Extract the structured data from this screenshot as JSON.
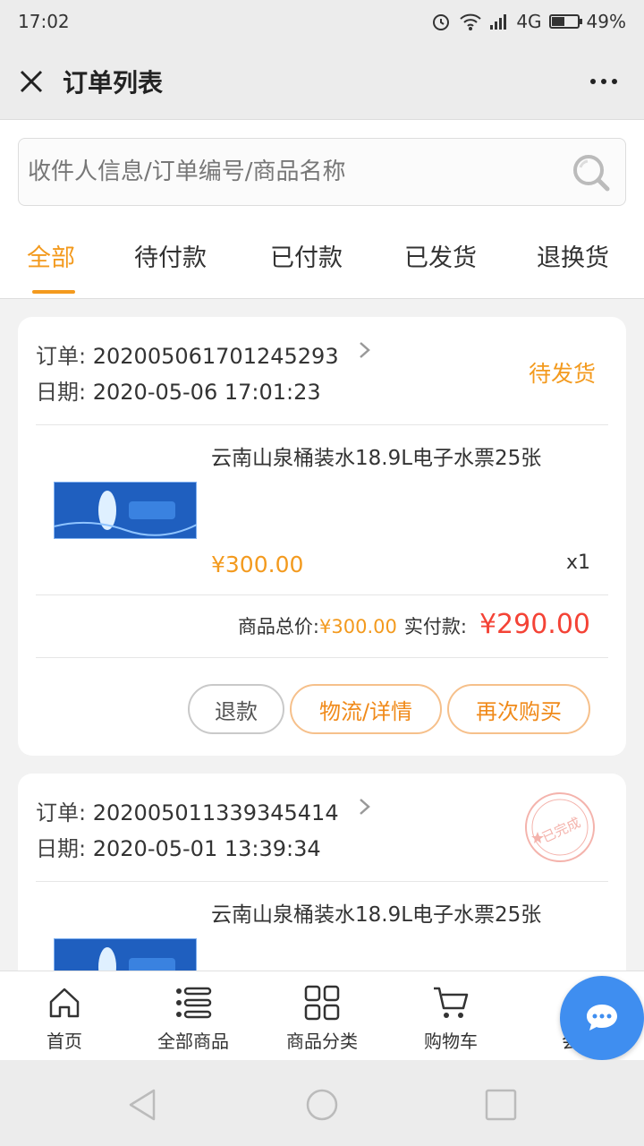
{
  "status_bar": {
    "time": "17:02",
    "network": "4G",
    "battery": "49%",
    "battery_level": 0.49
  },
  "title_bar": {
    "title": "订单列表"
  },
  "search": {
    "placeholder": "收件人信息/订单编号/商品名称"
  },
  "tabs": [
    {
      "label": "全部",
      "active": true
    },
    {
      "label": "待付款",
      "active": false
    },
    {
      "label": "已付款",
      "active": false
    },
    {
      "label": "已发货",
      "active": false
    },
    {
      "label": "退换货",
      "active": false
    }
  ],
  "orders": [
    {
      "order_label": "订单:",
      "order_no": "202005061701245293",
      "date_label": "日期:",
      "date": "2020-05-06 17:01:23",
      "status": "待发货",
      "product_name": "云南山泉桶装水18.9L电子水票25张",
      "price": "¥300.00",
      "quantity": "x1",
      "total_label": "商品总价:",
      "total": "¥300.00",
      "paid_label": "实付款:",
      "paid": "¥290.00",
      "buttons": [
        "退款",
        "物流/详情",
        "再次购买"
      ]
    },
    {
      "order_label": "订单:",
      "order_no": "202005011339345414",
      "date_label": "日期:",
      "date": "2020-05-01 13:39:34",
      "status_stamp": "已完成",
      "product_name": "云南山泉桶装水18.9L电子水票25张"
    }
  ],
  "bottom_nav": [
    {
      "label": "首页",
      "icon": "home-icon"
    },
    {
      "label": "全部商品",
      "icon": "list-icon"
    },
    {
      "label": "商品分类",
      "icon": "grid-icon"
    },
    {
      "label": "购物车",
      "icon": "cart-icon"
    },
    {
      "label": "会员",
      "icon": "member-icon"
    }
  ],
  "colors": {
    "accent": "#f39a1e",
    "price_red": "#f44336",
    "chat_blue": "#3f8ef0"
  }
}
